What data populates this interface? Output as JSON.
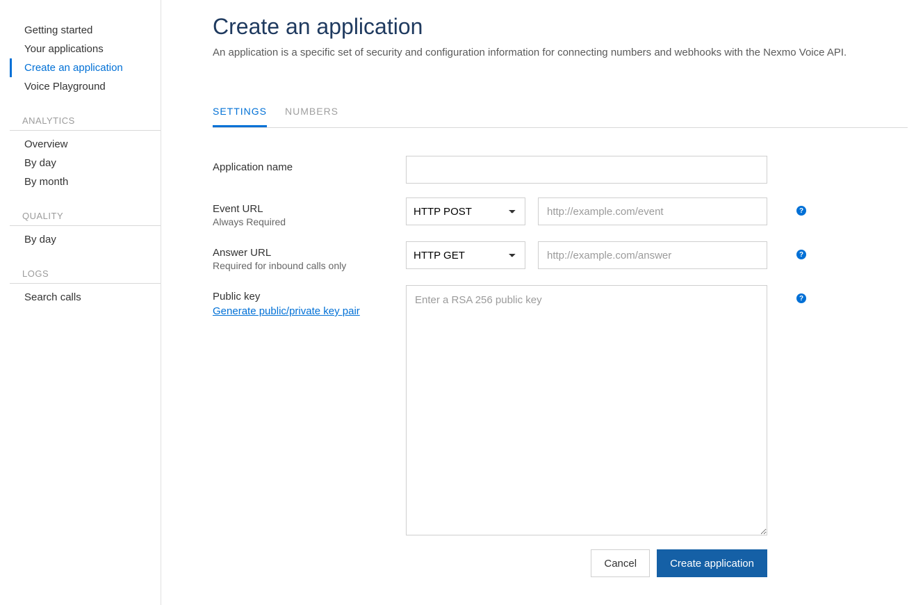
{
  "sidebar": {
    "top": [
      {
        "label": "Getting started"
      },
      {
        "label": "Your applications"
      },
      {
        "label": "Create an application",
        "active": true
      },
      {
        "label": "Voice Playground"
      }
    ],
    "sections": [
      {
        "header": "ANALYTICS",
        "items": [
          "Overview",
          "By day",
          "By month"
        ]
      },
      {
        "header": "QUALITY",
        "items": [
          "By day"
        ]
      },
      {
        "header": "LOGS",
        "items": [
          "Search calls"
        ]
      }
    ]
  },
  "page": {
    "title": "Create an application",
    "description": "An application is a specific set of security and configuration information for connecting numbers and webhooks with the Nexmo Voice API."
  },
  "tabs": [
    {
      "label": "SETTINGS",
      "active": true
    },
    {
      "label": "NUMBERS"
    }
  ],
  "form": {
    "app_name": {
      "label": "Application name",
      "value": ""
    },
    "event_url": {
      "label": "Event URL",
      "sub": "Always Required",
      "method": "HTTP POST",
      "placeholder": "http://example.com/event",
      "value": ""
    },
    "answer_url": {
      "label": "Answer URL",
      "sub": "Required for inbound calls only",
      "method": "HTTP GET",
      "placeholder": "http://example.com/answer",
      "value": ""
    },
    "public_key": {
      "label": "Public key",
      "gen_link": "Generate public/private key pair",
      "placeholder": "Enter a RSA 256 public key",
      "value": ""
    },
    "buttons": {
      "cancel": "Cancel",
      "submit": "Create application"
    }
  }
}
